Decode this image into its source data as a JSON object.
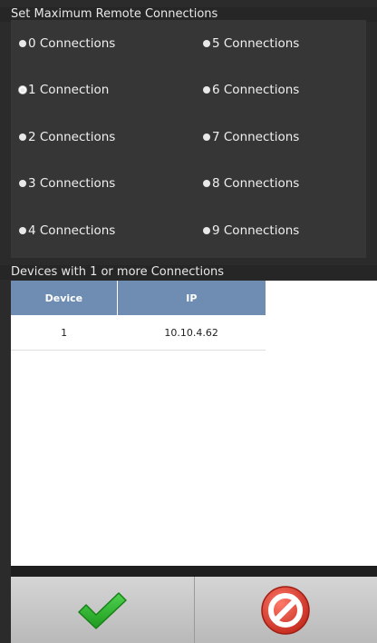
{
  "connections": {
    "title": "Set Maximum Remote Connections",
    "selected_index": 1,
    "options": [
      "0 Connections",
      "1 Connection",
      "2 Connections",
      "3 Connections",
      "4 Connections",
      "5 Connections",
      "6 Connections",
      "7 Connections",
      "8 Connections",
      "9 Connections"
    ]
  },
  "devices": {
    "title": "Devices with 1 or more Connections",
    "headers": [
      "Device",
      "IP"
    ],
    "rows": [
      [
        "1",
        "10.10.4.62"
      ]
    ]
  },
  "buttons": {
    "confirm_icon": "checkmark-icon",
    "cancel_icon": "no-entry-icon"
  },
  "colors": {
    "header_bg": "#6f8db2",
    "confirm": "#2db52d",
    "cancel": "#d93a2b"
  }
}
